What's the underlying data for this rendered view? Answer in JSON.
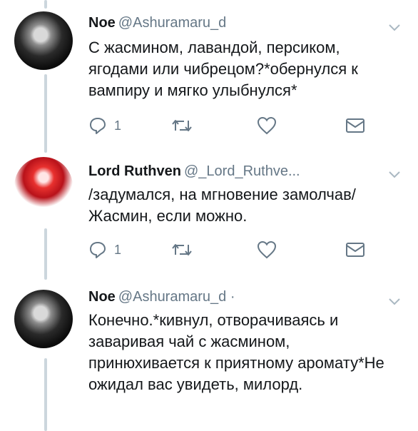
{
  "tweets": [
    {
      "name": "Noe",
      "handle": "@Ashuramaru_d",
      "text": "С жасмином, лавандой, персиком, ягодами или чибрецом?*обернулся к вампиру и мягко улыбнулся*",
      "reply_count": "1",
      "avatar_icon": "avatar-noe"
    },
    {
      "name": "Lord Ruthven",
      "handle": "@_Lord_Ruthve...",
      "text": "/задумался, на мгновение замолчав/ Жасмин, если можно.",
      "reply_count": "1",
      "avatar_icon": "avatar-ruthven"
    },
    {
      "name": "Noe",
      "handle": "@Ashuramaru_d ·",
      "text": "Конечно.*кивнул, отворачиваясь и заваривая чай с жасмином, принюхивается к приятному аромату*Не ожидал вас увидеть, милорд.",
      "avatar_icon": "avatar-noe"
    }
  ],
  "colors": {
    "icon_gray": "#657786",
    "thread_line": "#ccd6dd",
    "ruthven_red": "#d42a2a"
  }
}
